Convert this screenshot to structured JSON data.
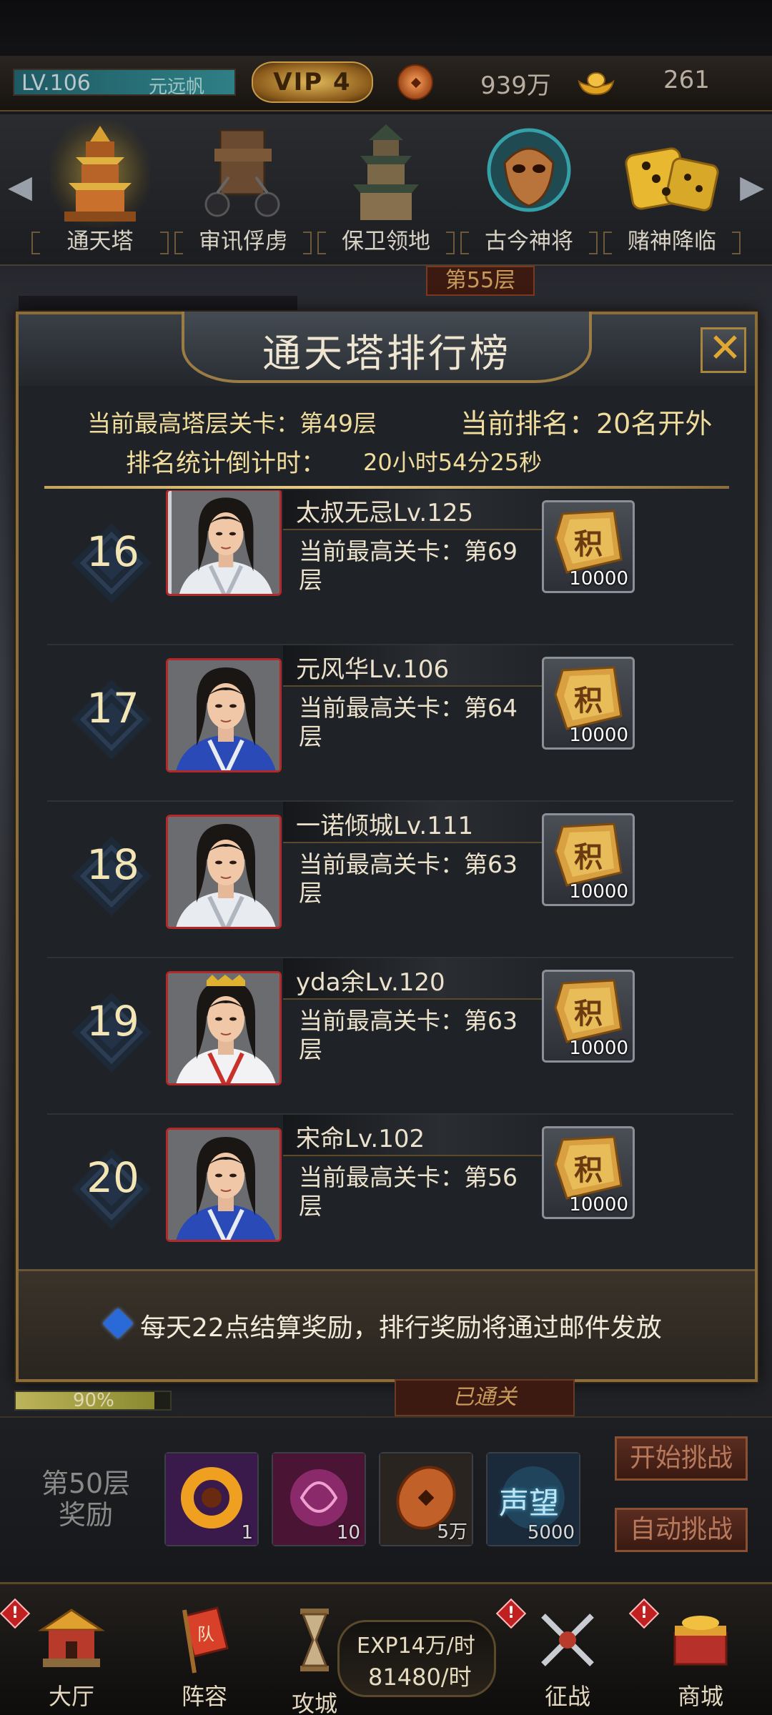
{
  "status_bar": {
    "level": "LV.106",
    "player_name": "元远帆",
    "vip": "VIP 4",
    "coins": "939万",
    "ingots": "261"
  },
  "activities": [
    {
      "label": "通天塔",
      "icon": "tower-icon",
      "selected": true
    },
    {
      "label": "审讯俘虏",
      "icon": "shackles-icon",
      "selected": false
    },
    {
      "label": "保卫领地",
      "icon": "pagoda-icon",
      "selected": false
    },
    {
      "label": "古今神将",
      "icon": "mask-icon",
      "selected": false
    },
    {
      "label": "赌神降临",
      "icon": "dice-icon",
      "selected": false
    }
  ],
  "background": {
    "floor_sign": "第55层",
    "progress_text": "90%",
    "progress": 0.9,
    "cleared_sign": "已通关"
  },
  "modal": {
    "title": "通天塔排行榜",
    "current_highest_floor": "当前最高塔层关卡：第49层",
    "current_rank": "当前排名：20名开外",
    "countdown_label": "排名统计倒计时：",
    "countdown_value": "20小时54分25秒",
    "rows": [
      {
        "rank": "16",
        "name": "太叔无忌Lv.125",
        "floor": "当前最高关卡：第69层",
        "reward_icon": "积",
        "reward_amount": "10000"
      },
      {
        "rank": "17",
        "name": "元风华Lv.106",
        "floor": "当前最高关卡：第64层",
        "reward_icon": "积",
        "reward_amount": "10000"
      },
      {
        "rank": "18",
        "name": "一诺倾城Lv.111",
        "floor": "当前最高关卡：第63层",
        "reward_icon": "积",
        "reward_amount": "10000"
      },
      {
        "rank": "19",
        "name": "yda余Lv.120",
        "floor": "当前最高关卡：第63层",
        "reward_icon": "积",
        "reward_amount": "10000"
      },
      {
        "rank": "20",
        "name": "宋命Lv.102",
        "floor": "当前最高关卡：第56层",
        "reward_icon": "积",
        "reward_amount": "10000"
      }
    ],
    "footer_note": "每天22点结算奖励，排行奖励将通过邮件发放"
  },
  "challenge": {
    "floor_reward_label": "第50层奖励",
    "items": [
      {
        "icon": "gold-ring-icon",
        "qty": "1"
      },
      {
        "icon": "purple-orb-icon",
        "qty": "10"
      },
      {
        "icon": "copper-coin-icon",
        "qty": "5万"
      },
      {
        "icon": "prestige-icon",
        "label": "声望",
        "qty": "5000"
      }
    ],
    "start_button": "开始挑战",
    "auto_button": "自动挑战"
  },
  "nav": {
    "items": [
      {
        "label": "大厅",
        "icon": "palace-icon",
        "badge": "!"
      },
      {
        "label": "阵容",
        "icon": "banner-icon",
        "badge": "",
        "banner_char": "队"
      },
      {
        "label": "攻城",
        "icon": "hourglass-icon",
        "badge": ""
      },
      {
        "label": "征战",
        "icon": "swords-icon",
        "badge": "!"
      },
      {
        "label": "商城",
        "icon": "treasure-icon",
        "badge": "!"
      }
    ],
    "exp_rate": "EXP14万/时",
    "coin_rate": "81480/时"
  },
  "colors": {
    "gold_text": "#f0dc9c",
    "frame_gold": "#8a6d3a",
    "avatar_border": "#b32828",
    "info_diamond": "#2a6ad8"
  }
}
